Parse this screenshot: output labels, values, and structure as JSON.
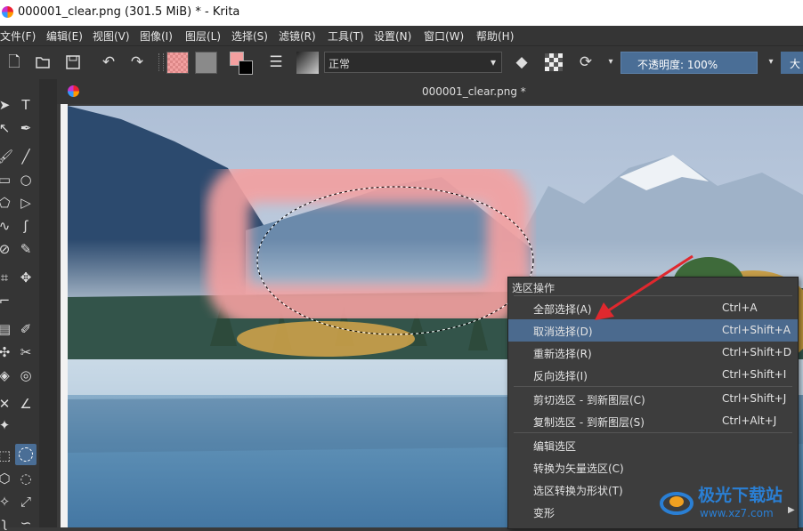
{
  "window": {
    "title": "000001_clear.png (301.5 MiB)  * - Krita"
  },
  "menubar": {
    "items": [
      "文件(F)",
      "编辑(E)",
      "视图(V)",
      "图像(I)",
      "图层(L)",
      "选择(S)",
      "滤镜(R)",
      "工具(T)",
      "设置(N)",
      "窗口(W)",
      "帮助(H)"
    ]
  },
  "toolbar": {
    "blend_mode": "正常",
    "opacity_label": "不透明度:  100%",
    "size_label": "大"
  },
  "document_tab": {
    "title": "000001_clear.png *"
  },
  "context_menu": {
    "header": "选区操作",
    "items": [
      {
        "label": "全部选择(A)",
        "shortcut": "Ctrl+A"
      },
      {
        "label": "取消选择(D)",
        "shortcut": "Ctrl+Shift+A",
        "highlighted": true
      },
      {
        "label": "重新选择(R)",
        "shortcut": "Ctrl+Shift+D"
      },
      {
        "label": "反向选择(I)",
        "shortcut": "Ctrl+Shift+I"
      },
      {
        "label": "剪切选区 - 到新图层(C)",
        "shortcut": "Ctrl+Shift+J"
      },
      {
        "label": "复制选区 - 到新图层(S)",
        "shortcut": "Ctrl+Alt+J"
      },
      {
        "label": "编辑选区",
        "shortcut": ""
      },
      {
        "label": "转换为矢量选区(C)",
        "shortcut": ""
      },
      {
        "label": "选区转换为形状(T)",
        "shortcut": ""
      },
      {
        "label": "变形",
        "shortcut": ""
      }
    ]
  },
  "watermark": {
    "text": "极光下载站",
    "url_text": "www.xz7.com"
  },
  "colors": {
    "highlight": "#4b6a8e",
    "accent": "#4a6e96",
    "annotation_arrow": "#e0282e",
    "brush_stroke": "#f4a0a0"
  }
}
